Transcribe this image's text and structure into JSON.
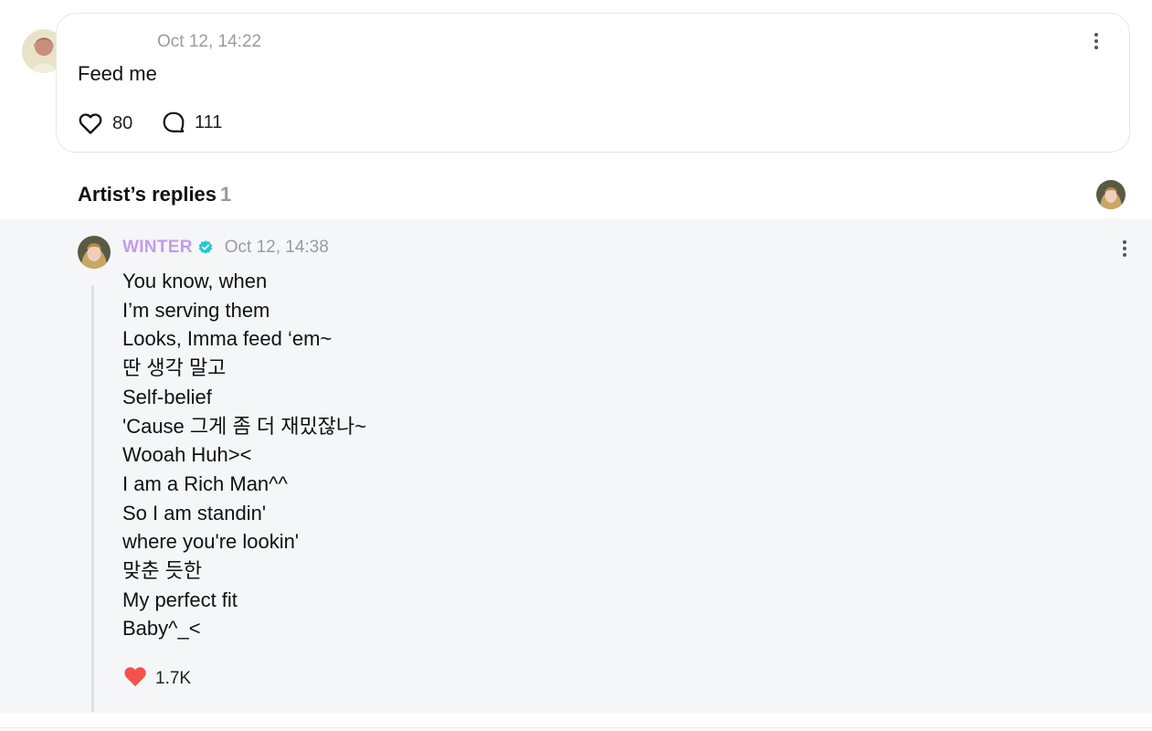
{
  "post": {
    "time": "Oct 12, 14:22",
    "text": "Feed me",
    "likes": "80",
    "comments": "111"
  },
  "replies_section": {
    "title": "Artist’s replies",
    "count": "1"
  },
  "reply": {
    "author": "WINTER",
    "verified": true,
    "time": "Oct 12, 14:38",
    "lines": [
      "You know, when",
      "I’m serving them",
      "Looks, Imma feed ‘em~",
      "딴 생각 말고",
      "Self-belief",
      "'Cause 그게 좀 더 재밌잖나~",
      "Wooah Huh><",
      "I am a Rich Man^^",
      "So I am standin'",
      "where you're lookin'",
      "맞춘 듯한",
      "My perfect fit",
      "Baby^_<"
    ],
    "likes": "1.7K"
  },
  "colors": {
    "artist_name": "#c59bef",
    "verified_badge": "#1ec8d8",
    "liked_heart": "#f4524d",
    "reply_background": "#f5f6f8"
  },
  "icons": {
    "like": "heart-outline-icon",
    "comment": "speech-bubble-icon",
    "more": "vertical-ellipsis-icon",
    "liked": "heart-filled-icon",
    "verified": "verified-badge-icon"
  }
}
